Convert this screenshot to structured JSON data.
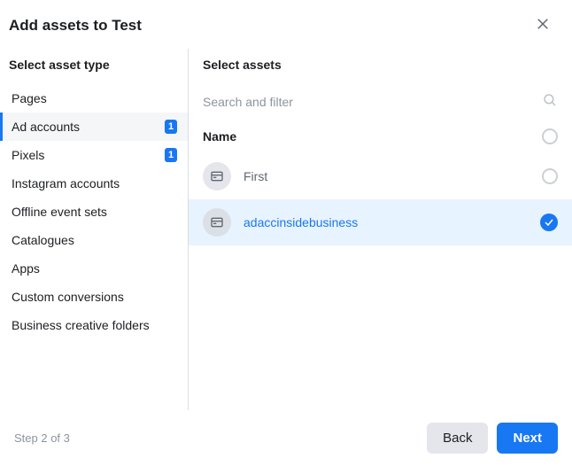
{
  "header": {
    "title": "Add assets to Test"
  },
  "left": {
    "title": "Select asset type",
    "types": [
      {
        "label": "Pages",
        "badge": null,
        "selected": false
      },
      {
        "label": "Ad accounts",
        "badge": "1",
        "selected": true
      },
      {
        "label": "Pixels",
        "badge": "1",
        "selected": false
      },
      {
        "label": "Instagram accounts",
        "badge": null,
        "selected": false
      },
      {
        "label": "Offline event sets",
        "badge": null,
        "selected": false
      },
      {
        "label": "Catalogues",
        "badge": null,
        "selected": false
      },
      {
        "label": "Apps",
        "badge": null,
        "selected": false
      },
      {
        "label": "Custom conversions",
        "badge": null,
        "selected": false
      },
      {
        "label": "Business creative folders",
        "badge": null,
        "selected": false
      }
    ]
  },
  "right": {
    "title": "Select assets",
    "search_placeholder": "Search and filter",
    "column_header": "Name",
    "assets": [
      {
        "label": "First",
        "selected": false
      },
      {
        "label": "adaccinsidebusiness",
        "selected": true
      }
    ]
  },
  "footer": {
    "step": "Step 2 of 3",
    "back": "Back",
    "next": "Next"
  }
}
